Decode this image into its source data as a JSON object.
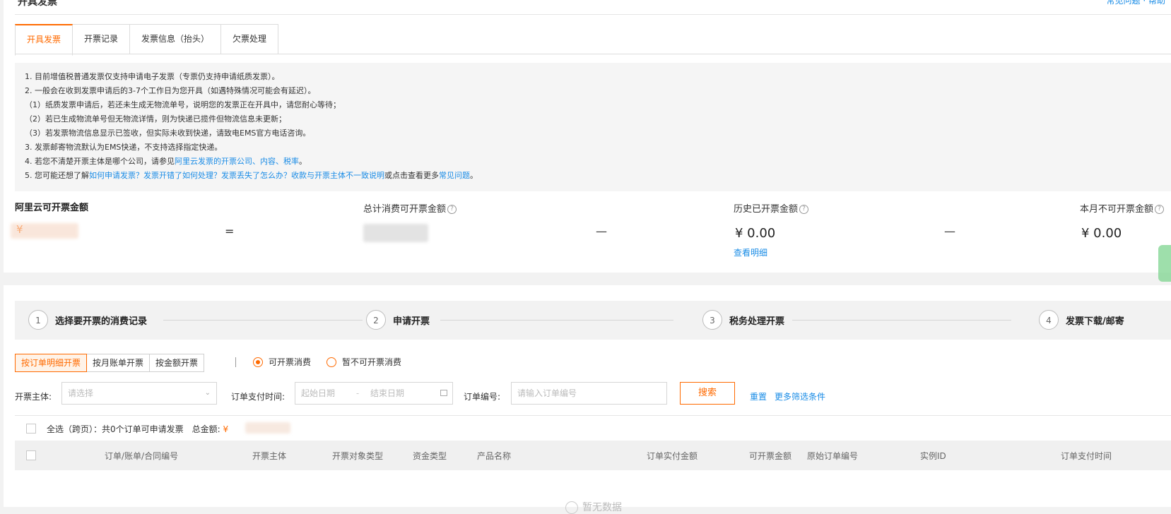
{
  "header": {
    "title_fragment": "开具发票",
    "right_link_fragment": "常见问题 · 帮助"
  },
  "tabs": [
    {
      "label": "开具发票",
      "active": true
    },
    {
      "label": "开票记录",
      "active": false
    },
    {
      "label": "发票信息（抬头）",
      "active": false
    },
    {
      "label": "欠票处理",
      "active": false
    }
  ],
  "notice": {
    "line1": "1. 目前增值税普通发票仅支持申请电子发票（专票仍支持申请纸质发票）。",
    "line2": "2. 一般会在收到发票申请后的3-7个工作日为您开具（如遇特殊情况可能会有延迟）。",
    "line3": "（1）纸质发票申请后，若还未生成无物流单号，说明您的发票正在开具中，请您耐心等待；",
    "line4": "（2）若已生成物流单号但无物流详情，则为快递已揽件但物流信息未更新；",
    "line5": "（3）若发票物流信息显示已签收，但实际未收到快递，请致电EMS官方电话咨询。",
    "line6": "3. 发票邮寄物流默认为EMS快递，不支持选择指定快递。",
    "line7_prefix": "4. 若您不清楚开票主体是哪个公司，请参见",
    "line7_link": "阿里云发票的开票公司、内容、税率",
    "line7_suffix": "。",
    "line8_prefix": "5. 您可能还想了解",
    "line8_link": "如何申请发票？发票开错了如何处理？发票丢失了怎么办？收款与开票主体不一致说明",
    "line8_middle": "或点击查看更多",
    "line8_link2": "常见问题",
    "line8_suffix": "。"
  },
  "amounts": {
    "available_label": "阿里云可开票金额",
    "available_value_prefix": "¥",
    "equals": "=",
    "total_label": "总计消费可开票金额",
    "minus": "—",
    "history_label": "历史已开票金额",
    "history_value": "¥ 0.00",
    "detail_link": "查看明细",
    "month_label": "本月不可开票金额",
    "month_value": "¥ 0.00",
    "help_icon": "?"
  },
  "steps": [
    {
      "num": "1",
      "label": "选择要开票的消费记录"
    },
    {
      "num": "2",
      "label": "申请开票"
    },
    {
      "num": "3",
      "label": "税务处理开票"
    },
    {
      "num": "4",
      "label": "发票下载/邮寄"
    }
  ],
  "filters": {
    "modes": [
      {
        "label": "按订单明细开票",
        "active": true
      },
      {
        "label": "按月账单开票",
        "active": false
      },
      {
        "label": "按金额开票",
        "active": false
      }
    ],
    "radio_options": [
      {
        "label": "可开票消费",
        "checked": true
      },
      {
        "label": "暂不可开票消费",
        "checked": false
      }
    ],
    "entity_label": "开票主体:",
    "entity_placeholder": "请选择",
    "paytime_label": "订单支付时间:",
    "start_placeholder": "起始日期",
    "date_sep": "-",
    "end_placeholder": "结束日期",
    "order_label": "订单编号:",
    "order_placeholder": "请输入订单编号",
    "search_button": "搜索",
    "reset_link": "重置",
    "more_link": "更多筛选条件"
  },
  "select_all": {
    "text": "全选（跨页）：共0个订单可申请发票",
    "total_label": "总金额:",
    "total_prefix": "¥"
  },
  "table": {
    "columns": [
      "订单/账单/合同编号",
      "开票主体",
      "开票对象类型",
      "资金类型",
      "产品名称",
      "订单实付金额",
      "可开票金额",
      "原始订单编号",
      "实例ID",
      "订单支付时间"
    ],
    "empty_text": "暂无数据"
  }
}
